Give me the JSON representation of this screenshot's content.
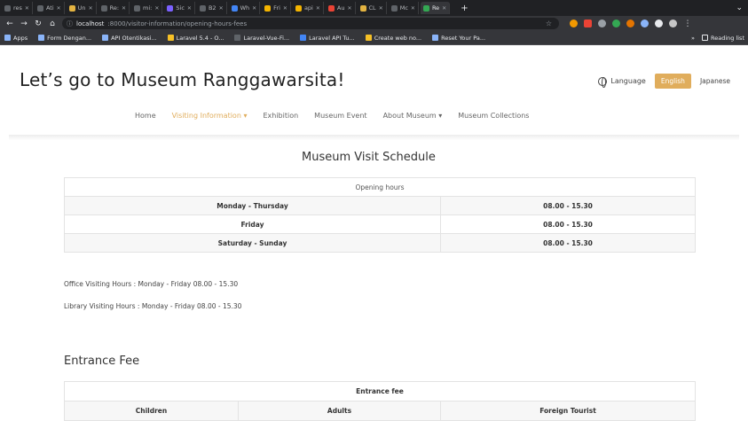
{
  "browser": {
    "tabs": [
      {
        "label": "res",
        "color": "#5f6368"
      },
      {
        "label": "Ati",
        "color": "#5f6368"
      },
      {
        "label": "Un",
        "color": "#e3b341"
      },
      {
        "label": "Re:",
        "color": "#5f6368"
      },
      {
        "label": "mi:",
        "color": "#5f6368"
      },
      {
        "label": "Sic",
        "color": "#7b61ff"
      },
      {
        "label": "B2",
        "color": "#5f6368"
      },
      {
        "label": "Wh",
        "color": "#4285f4"
      },
      {
        "label": "Fri",
        "color": "#f4b400"
      },
      {
        "label": "api",
        "color": "#f4b400"
      },
      {
        "label": "Au",
        "color": "#ea4335"
      },
      {
        "label": "CL",
        "color": "#e3b341"
      },
      {
        "label": "Mc",
        "color": "#5f6368"
      },
      {
        "label": "Re",
        "color": "#34a853"
      }
    ],
    "new_tab": "+",
    "url_host": "localhost",
    "url_path": ":8000/visitor-information/opening-hours-fees",
    "bookmarks": [
      {
        "label": "Apps",
        "color": "#8ab4f8"
      },
      {
        "label": "Form Dengan...",
        "color": "#8ab4f8"
      },
      {
        "label": "API Otentikasi...",
        "color": "#8ab4f8"
      },
      {
        "label": "Laravel 5.4 - O...",
        "color": "#f6c026"
      },
      {
        "label": "Laravel-Vue-Fi...",
        "color": "#5f6368"
      },
      {
        "label": "Laravel API Tu...",
        "color": "#4285f4"
      },
      {
        "label": "Create web no...",
        "color": "#f6c026"
      },
      {
        "label": "Reset Your Pa...",
        "color": "#8ab4f8"
      }
    ],
    "reading_list": "Reading list"
  },
  "header": {
    "title": "Let’s go to Museum Ranggawarsita!",
    "language_label": "Language",
    "english": "English",
    "japanese": "Japanese"
  },
  "nav": {
    "home": "Home",
    "visiting_information": "Visiting Information ▾",
    "exhibition": "Exhibition",
    "museum_event": "Museum Event",
    "about_museum": "About Museum ▾",
    "museum_collections": "Museum Collections"
  },
  "schedule": {
    "title": "Museum Visit Schedule",
    "caption": "Opening hours",
    "rows": [
      {
        "day": "Monday - Thursday",
        "hours": "08.00 - 15.30"
      },
      {
        "day": "Friday",
        "hours": "08.00 - 15.30"
      },
      {
        "day": "Saturday - Sunday",
        "hours": "08.00 - 15.30"
      }
    ],
    "office_hours": "Office Visiting Hours : Monday - Friday 08.00 - 15.30",
    "library_hours": "Library Visiting Hours : Monday - Friday 08.00 - 15.30"
  },
  "fees": {
    "title": "Entrance Fee",
    "caption": "Entrance fee",
    "columns": [
      "Children",
      "Adults",
      "Foreign Tourist"
    ]
  }
}
